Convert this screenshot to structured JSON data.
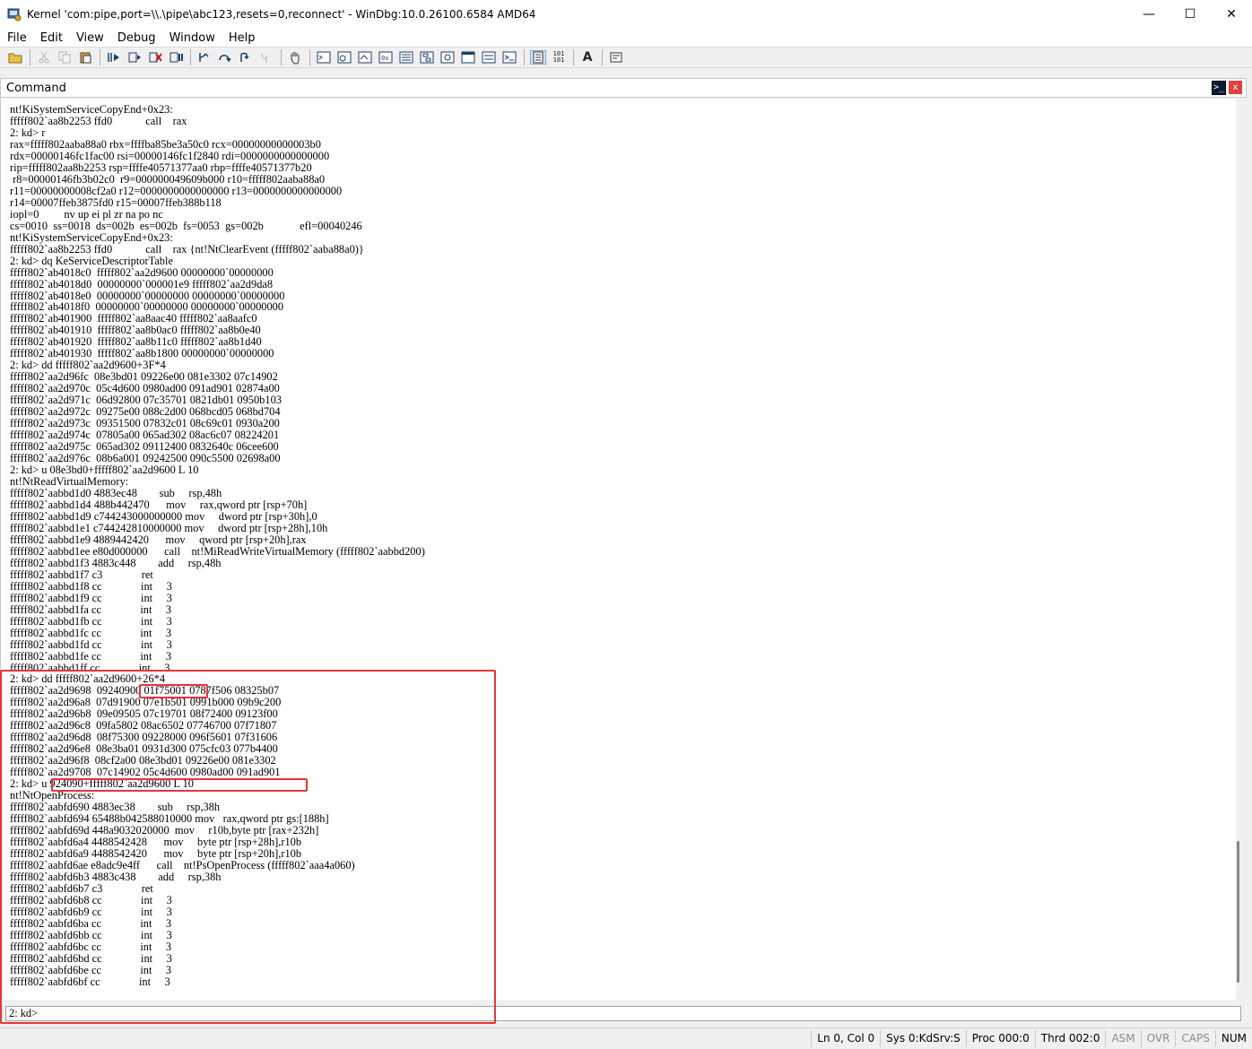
{
  "window": {
    "title": "Kernel 'com:pipe,port=\\\\.\\pipe\\abc123,resets=0,reconnect' - WinDbg:10.0.26100.6584 AMD64",
    "minimize_glyph": "—",
    "maximize_glyph": "☐",
    "close_glyph": "✕"
  },
  "menu": {
    "items": [
      "File",
      "Edit",
      "View",
      "Debug",
      "Window",
      "Help"
    ]
  },
  "toolbar": {
    "font_button": "A",
    "hex_button_top": "101",
    "hex_button_bottom": "101"
  },
  "command_pane": {
    "title": "Command",
    "dock_glyph": ">_",
    "close_glyph": "x",
    "output_lines": [
      "nt!KiSystemServiceCopyEnd+0x23:",
      "fffff802`aa8b2253 ffd0            call    rax",
      "2: kd> r",
      "rax=fffff802aaba88a0 rbx=ffffba85be3a50c0 rcx=00000000000003b0",
      "rdx=00000146fc1fac00 rsi=00000146fc1f2840 rdi=0000000000000000",
      "rip=fffff802aa8b2253 rsp=ffffe40571377aa0 rbp=ffffe40571377b20",
      " r8=00000146fb3b02c0  r9=000000049609b000 r10=fffff802aaba88a0",
      "r11=00000000008cf2a0 r12=0000000000000000 r13=0000000000000000",
      "r14=00007ffeb3875fd0 r15=00007ffeb388b118",
      "iopl=0         nv up ei pl zr na po nc",
      "cs=0010  ss=0018  ds=002b  es=002b  fs=0053  gs=002b             efl=00040246",
      "nt!KiSystemServiceCopyEnd+0x23:",
      "fffff802`aa8b2253 ffd0            call    rax {nt!NtClearEvent (fffff802`aaba88a0)}",
      "2: kd> dq KeServiceDescriptorTable",
      "fffff802`ab4018c0  fffff802`aa2d9600 00000000`00000000",
      "fffff802`ab4018d0  00000000`000001e9 fffff802`aa2d9da8",
      "fffff802`ab4018e0  00000000`00000000 00000000`00000000",
      "fffff802`ab4018f0  00000000`00000000 00000000`00000000",
      "fffff802`ab401900  fffff802`aa8aac40 fffff802`aa8aafc0",
      "fffff802`ab401910  fffff802`aa8b0ac0 fffff802`aa8b0e40",
      "fffff802`ab401920  fffff802`aa8b11c0 fffff802`aa8b1d40",
      "fffff802`ab401930  fffff802`aa8b1800 00000000`00000000",
      "2: kd> dd fffff802`aa2d9600+3F*4",
      "fffff802`aa2d96fc  08e3bd01 09226e00 081e3302 07c14902",
      "fffff802`aa2d970c  05c4d600 0980ad00 091ad901 02874a00",
      "fffff802`aa2d971c  06d92800 07c35701 0821db01 0950b103",
      "fffff802`aa2d972c  09275e00 088c2d00 068bcd05 068bd704",
      "fffff802`aa2d973c  09351500 07832c01 08c69c01 0930a200",
      "fffff802`aa2d974c  07805a00 065ad302 08ac6c07 08224201",
      "fffff802`aa2d975c  065ad302 09112400 0832640c 06cee600",
      "fffff802`aa2d976c  08b6a001 09242500 090c5500 02698a00",
      "2: kd> u 08e3bd0+fffff802`aa2d9600 L 10",
      "nt!NtReadVirtualMemory:",
      "fffff802`aabbd1d0 4883ec48        sub     rsp,48h",
      "fffff802`aabbd1d4 488b442470      mov     rax,qword ptr [rsp+70h]",
      "fffff802`aabbd1d9 c744243000000000 mov     dword ptr [rsp+30h],0",
      "fffff802`aabbd1e1 c744242810000000 mov     dword ptr [rsp+28h],10h",
      "fffff802`aabbd1e9 4889442420      mov     qword ptr [rsp+20h],rax",
      "fffff802`aabbd1ee e80d000000      call    nt!MiReadWriteVirtualMemory (fffff802`aabbd200)",
      "fffff802`aabbd1f3 4883c448        add     rsp,48h",
      "fffff802`aabbd1f7 c3              ret",
      "fffff802`aabbd1f8 cc              int     3",
      "fffff802`aabbd1f9 cc              int     3",
      "fffff802`aabbd1fa cc              int     3",
      "fffff802`aabbd1fb cc              int     3",
      "fffff802`aabbd1fc cc              int     3",
      "fffff802`aabbd1fd cc              int     3",
      "fffff802`aabbd1fe cc              int     3",
      "fffff802`aabbd1ff cc              int     3",
      "2: kd> dd fffff802`aa2d9600+26*4",
      "fffff802`aa2d9698  09240900 01f75001 0787f506 08325b07",
      "fffff802`aa2d96a8  07d91900 07e1b501 0991b000 09b9c200",
      "fffff802`aa2d96b8  09e09505 07c19701 08f72400 09123f00",
      "fffff802`aa2d96c8  09fa5802 08ac6502 07746700 07f71807",
      "fffff802`aa2d96d8  08f75300 09228000 096f5601 07f31606",
      "fffff802`aa2d96e8  08e3ba01 0931d300 075cfc03 077b4400",
      "fffff802`aa2d96f8  08cf2a00 08e3bd01 09226e00 081e3302",
      "fffff802`aa2d9708  07c14902 05c4d600 0980ad00 091ad901",
      "2: kd> u 924090+fffff802`aa2d9600 L 10",
      "nt!NtOpenProcess:",
      "fffff802`aabfd690 4883ec38        sub     rsp,38h",
      "fffff802`aabfd694 65488b042588010000 mov   rax,qword ptr gs:[188h]",
      "fffff802`aabfd69d 448a9032020000  mov     r10b,byte ptr [rax+232h]",
      "fffff802`aabfd6a4 4488542428      mov     byte ptr [rsp+28h],r10b",
      "fffff802`aabfd6a9 4488542420      mov     byte ptr [rsp+20h],r10b",
      "fffff802`aabfd6ae e8adc9e4ff      call    nt!PsOpenProcess (fffff802`aaa4a060)",
      "fffff802`aabfd6b3 4883c438        add     rsp,38h",
      "fffff802`aabfd6b7 c3              ret",
      "fffff802`aabfd6b8 cc              int     3",
      "fffff802`aabfd6b9 cc              int     3",
      "fffff802`aabfd6ba cc              int     3",
      "fffff802`aabfd6bb cc              int     3",
      "fffff802`aabfd6bc cc              int     3",
      "fffff802`aabfd6bd cc              int     3",
      "fffff802`aabfd6be cc              int     3",
      "fffff802`aabfd6bf cc              int     3"
    ],
    "prompt": "2: kd>",
    "input_value": ""
  },
  "status_bar": {
    "position": "Ln 0, Col 0",
    "system": "Sys 0:KdSrv:S",
    "process": "Proc 000:0",
    "thread": "Thrd 002:0",
    "asm": "ASM",
    "ovr": "OVR",
    "caps": "CAPS",
    "num": "NUM"
  },
  "colors": {
    "highlight": "#e8343c"
  }
}
